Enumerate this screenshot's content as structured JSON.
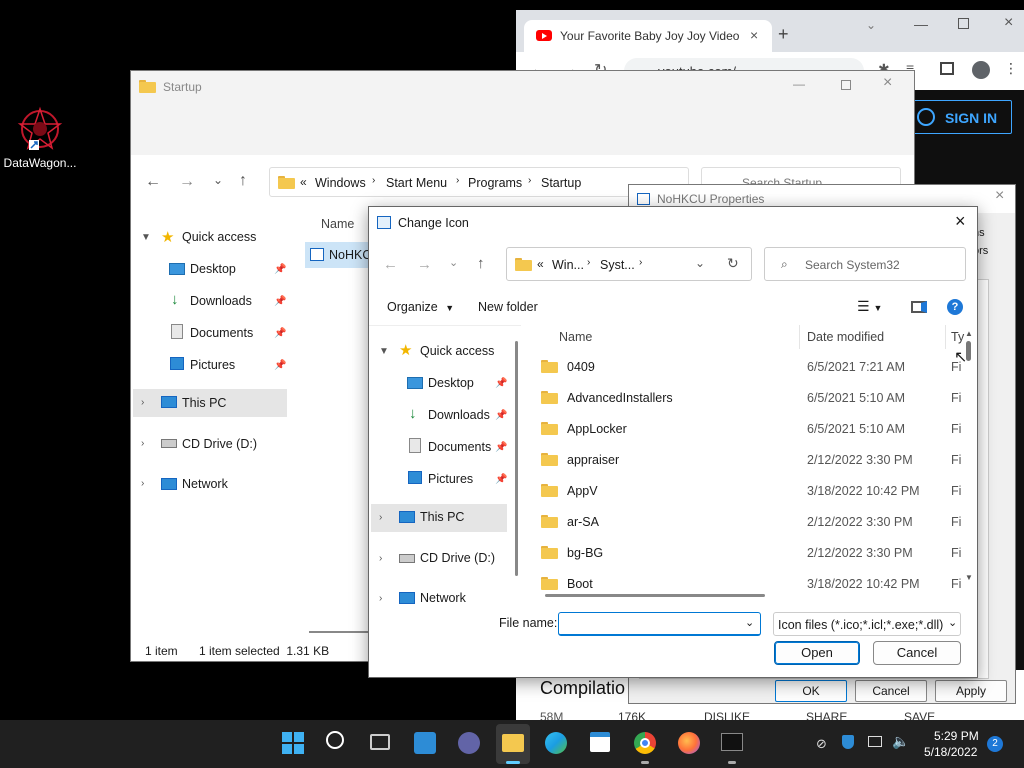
{
  "desktop": {
    "shortcut_label": "DataWagon..."
  },
  "browser": {
    "tab_title": "Your Favorite Baby Joy Joy Video",
    "url": "youtube.com/...",
    "sign_in": "SIGN IN",
    "video_title": "Compilatio",
    "views": "58M",
    "likes": "176K",
    "dislike": "DISLIKE",
    "share": "SHARE",
    "save": "SAVE"
  },
  "explorer": {
    "title": "Startup",
    "breadcrumb": [
      "Windows",
      "Start Menu",
      "Programs",
      "Startup"
    ],
    "search_placeholder": "Search Startup",
    "column_name": "Name",
    "file_item": "NoHKCU",
    "nav": {
      "quick_access": "Quick access",
      "desktop": "Desktop",
      "downloads": "Downloads",
      "documents": "Documents",
      "pictures": "Pictures",
      "this_pc": "This PC",
      "cd_drive": "CD Drive (D:)",
      "network": "Network"
    },
    "status_items": "1 item",
    "status_selected": "1 item selected  1.31 KB"
  },
  "properties": {
    "title": "NoHKCU Properties",
    "tab_partial_1": "ns",
    "tab_partial_2": "ors",
    "ok": "OK",
    "cancel": "Cancel",
    "apply": "Apply"
  },
  "dialog": {
    "title": "Change Icon",
    "breadcrumb": [
      "Win...",
      "Syst..."
    ],
    "search_placeholder": "Search System32",
    "organize": "Organize",
    "new_folder": "New folder",
    "col_name": "Name",
    "col_date": "Date modified",
    "col_type": "Ty",
    "nav": {
      "quick_access": "Quick access",
      "desktop": "Desktop",
      "downloads": "Downloads",
      "documents": "Documents",
      "pictures": "Pictures",
      "this_pc": "This PC",
      "cd_drive": "CD Drive (D:)",
      "network": "Network"
    },
    "files": [
      {
        "name": "0409",
        "date": "6/5/2021 7:21 AM",
        "type": "Fi"
      },
      {
        "name": "AdvancedInstallers",
        "date": "6/5/2021 5:10 AM",
        "type": "Fi"
      },
      {
        "name": "AppLocker",
        "date": "6/5/2021 5:10 AM",
        "type": "Fi"
      },
      {
        "name": "appraiser",
        "date": "2/12/2022 3:30 PM",
        "type": "Fi"
      },
      {
        "name": "AppV",
        "date": "3/18/2022 10:42 PM",
        "type": "Fi"
      },
      {
        "name": "ar-SA",
        "date": "2/12/2022 3:30 PM",
        "type": "Fi"
      },
      {
        "name": "bg-BG",
        "date": "2/12/2022 3:30 PM",
        "type": "Fi"
      },
      {
        "name": "Boot",
        "date": "3/18/2022 10:42 PM",
        "type": "Fi"
      }
    ],
    "file_name_label": "File name:",
    "file_name_value": "",
    "filter": "Icon files (*.ico;*.icl;*.exe;*.dll)",
    "open": "Open",
    "cancel": "Cancel"
  },
  "taskbar": {
    "time": "5:29 PM",
    "date": "5/18/2022",
    "notification_count": "2"
  },
  "colors": {
    "accent": "#0078d4",
    "youtube_red": "#ff0000",
    "selection": "#cce4f7",
    "hover": "#e5e5e5"
  }
}
